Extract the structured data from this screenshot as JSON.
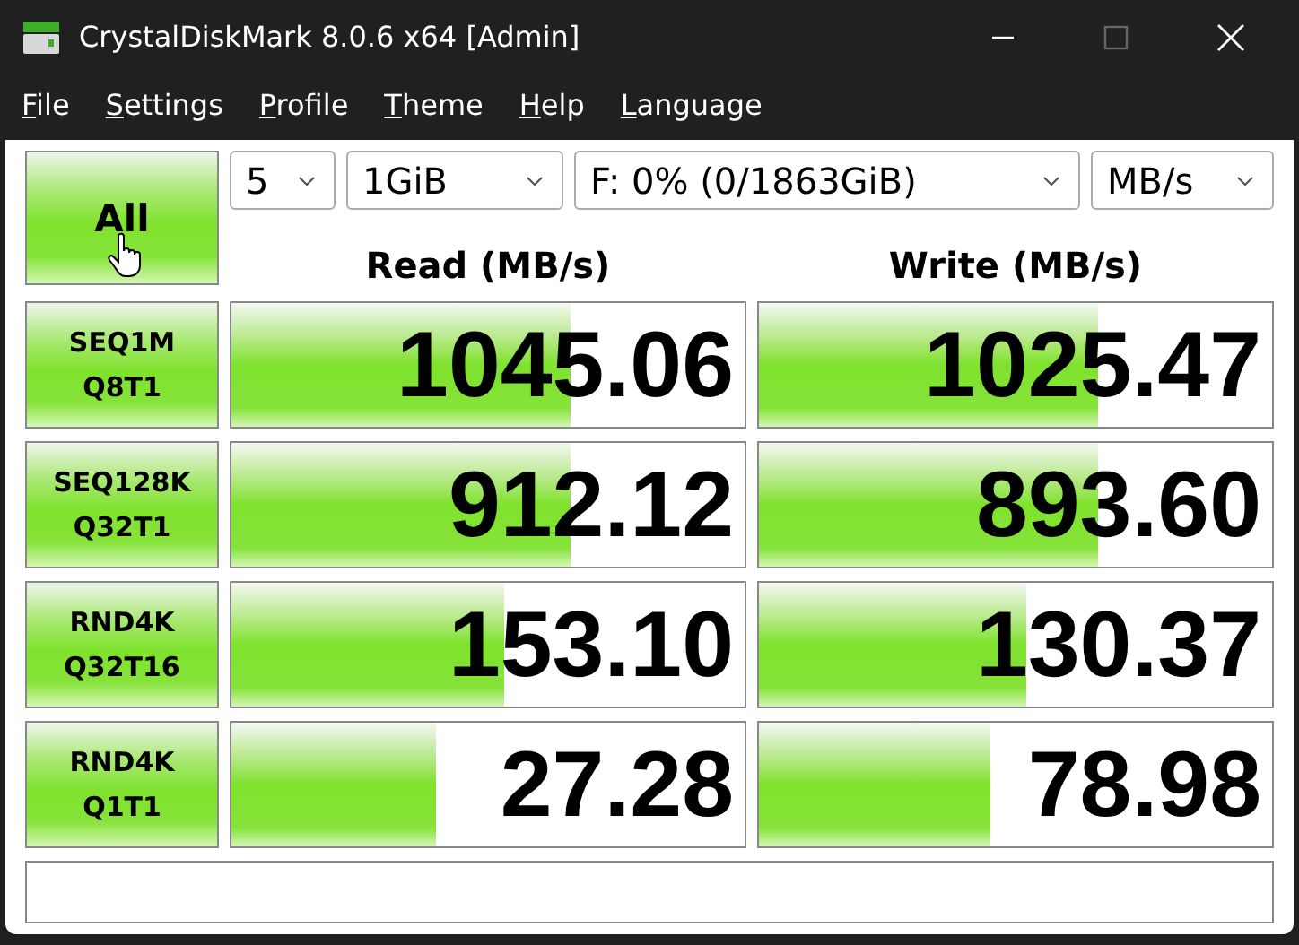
{
  "window": {
    "title": "CrystalDiskMark 8.0.6 x64 [Admin]",
    "maximize_disabled": true
  },
  "menu": [
    {
      "label": "File"
    },
    {
      "label": "Settings"
    },
    {
      "label": "Profile"
    },
    {
      "label": "Theme"
    },
    {
      "label": "Help"
    },
    {
      "label": "Language"
    }
  ],
  "all_button": {
    "label": "All"
  },
  "settings": [
    {
      "kind": "count",
      "value": "5"
    },
    {
      "kind": "size",
      "value": "1GiB"
    },
    {
      "kind": "drive",
      "value": "F: 0% (0/1863GiB)"
    },
    {
      "kind": "unit",
      "value": "MB/s"
    }
  ],
  "columns": [
    "Read (MB/s)",
    "Write (MB/s)"
  ],
  "tests": [
    {
      "name": "SEQ1M",
      "params": "Q8T1",
      "read": {
        "value": "1045.06",
        "level": 0.66
      },
      "write": {
        "value": "1025.47",
        "level": 0.66
      }
    },
    {
      "name": "SEQ128K",
      "params": "Q32T1",
      "read": {
        "value": "912.12",
        "level": 0.66
      },
      "write": {
        "value": "893.60",
        "level": 0.66
      }
    },
    {
      "name": "RND4K",
      "params": "Q32T16",
      "read": {
        "value": "153.10",
        "level": 0.53
      },
      "write": {
        "value": "130.37",
        "level": 0.52
      }
    },
    {
      "name": "RND4K",
      "params": "Q1T1",
      "read": {
        "value": "27.28",
        "level": 0.4
      },
      "write": {
        "value": "78.98",
        "level": 0.45
      }
    }
  ]
}
